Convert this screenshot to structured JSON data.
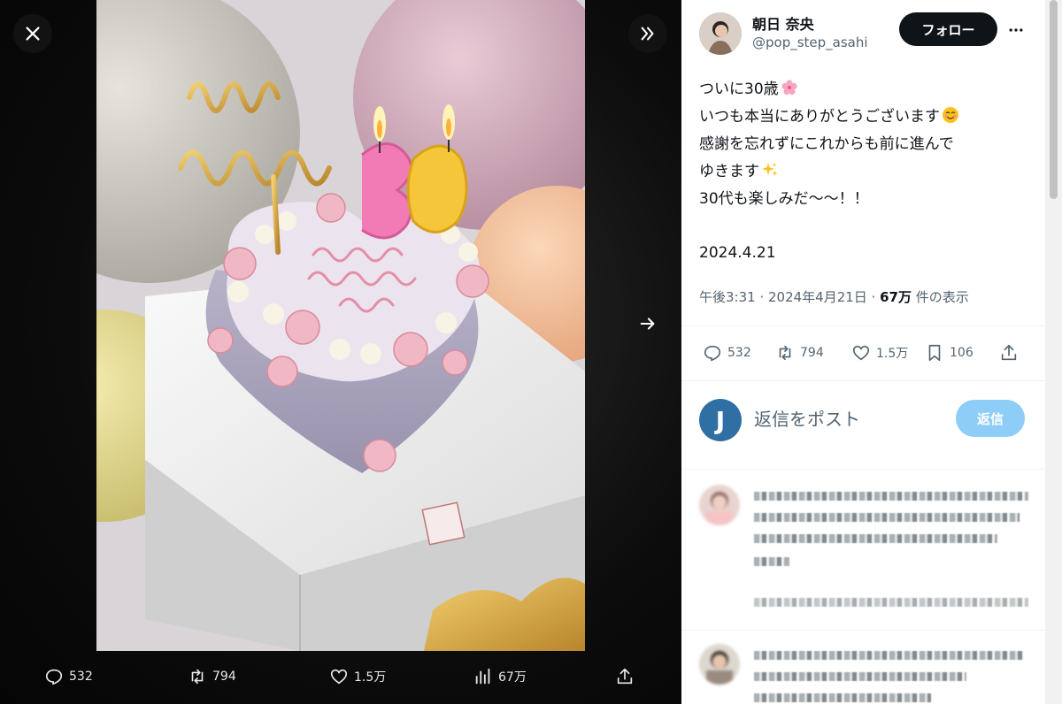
{
  "viewer": {
    "close_icon": "close-icon",
    "expand_icon": "double-chevron-right-icon",
    "next_icon": "arrow-right-icon",
    "actions": {
      "replies": "532",
      "retweets": "794",
      "likes": "1.5万",
      "views": "67万"
    }
  },
  "author": {
    "display_name": "朝日 奈央",
    "handle": "@pop_step_asahi",
    "follow_label": "フォロー"
  },
  "tweet": {
    "lines": [
      "ついに30歳",
      "いつも本当にありがとうございます",
      "感謝を忘れずにこれからも前に進んで",
      "ゆきます",
      "30代も楽しみだ〜〜！！"
    ],
    "date_text": "2024.4.21",
    "meta_time": "午後3:31 · 2024年4月21日 · ",
    "meta_views": "67万",
    "meta_views_suffix": " 件の表示"
  },
  "stats": {
    "replies": "532",
    "retweets": "794",
    "likes": "1.5万",
    "bookmarks": "106"
  },
  "reply_composer": {
    "avatar_letter": "J",
    "placeholder": "返信をポスト",
    "button_label": "返信"
  },
  "colors": {
    "follow_bg": "#0f1419",
    "reply_button": "#8ecdf8",
    "reply_avatar": "#2f6fa3",
    "secondary_text": "#536471"
  }
}
